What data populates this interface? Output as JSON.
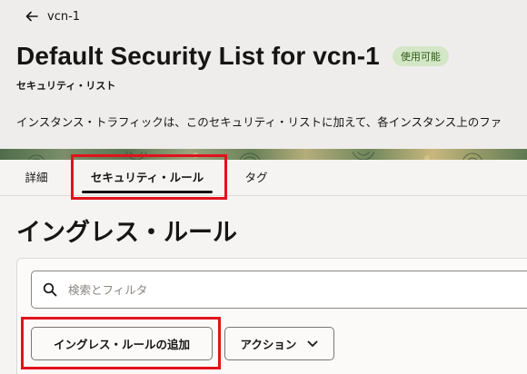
{
  "header": {
    "back_label": "vcn-1",
    "title": "Default Security List for vcn-1",
    "status_badge": "使用可能",
    "subtitle": "セキュリティ・リスト",
    "description": "インスタンス・トラフィックは、このセキュリティ・リストに加えて、各インスタンス上のファ"
  },
  "tabs": [
    {
      "label": "詳細",
      "active": false
    },
    {
      "label": "セキュリティ・ルール",
      "active": true
    },
    {
      "label": "タグ",
      "active": false
    }
  ],
  "section": {
    "title": "イングレス・ルール"
  },
  "search": {
    "placeholder": "検索とフィルタ",
    "value": ""
  },
  "actions": {
    "add_label": "イングレス・ルールの追加",
    "actions_label": "アクション"
  },
  "colors": {
    "highlight": "#e0131d",
    "badge_bg": "#d3e7c7",
    "badge_text": "#2d5a14"
  },
  "icons": [
    "arrow-left-icon",
    "search-icon",
    "chevron-down-icon"
  ]
}
